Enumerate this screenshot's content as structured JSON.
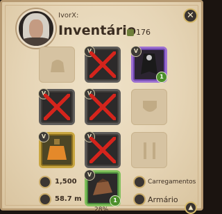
{
  "header": {
    "username": "IvorX:",
    "title": "Inventário",
    "weight": "176"
  },
  "slots": {
    "head": {
      "tier": "V"
    },
    "cape": {
      "tier": "V",
      "qty": "1"
    },
    "mainhand": {
      "tier": "V"
    },
    "chest": {
      "tier": "V"
    },
    "potion": {
      "tier": "V"
    },
    "shoes": {
      "tier": "V"
    },
    "mount": {
      "tier": "V",
      "qty": "1"
    }
  },
  "stats": {
    "silver": "1,500",
    "distance": "58.7 m",
    "load_label": "Carregamentos",
    "wardrobe_label": "Armário",
    "percent": "28%"
  },
  "icons": {
    "close": "close-icon",
    "scroll": "chevron-up-icon"
  },
  "colors": {
    "broken_mark": "#d4241c",
    "panel_bg": "#e6d5b6"
  }
}
